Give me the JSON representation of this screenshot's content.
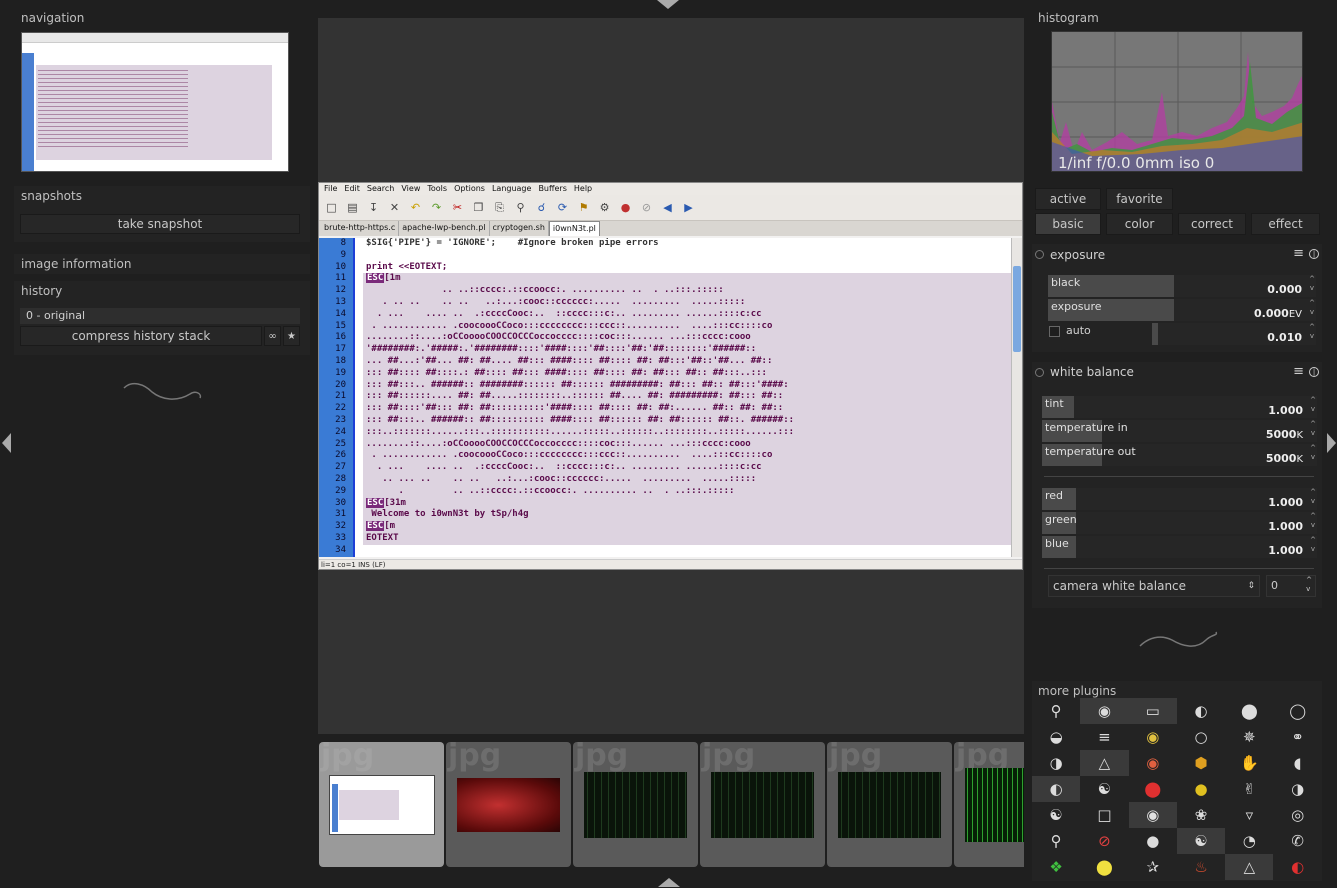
{
  "left": {
    "navigation_title": "navigation",
    "snapshots_title": "snapshots",
    "take_snapshot": "take snapshot",
    "image_info_title": "image information",
    "history_title": "history",
    "history_items": [
      "0 - original"
    ],
    "compress_history": "compress history stack"
  },
  "editor": {
    "menu": [
      "File",
      "Edit",
      "Search",
      "View",
      "Tools",
      "Options",
      "Language",
      "Buffers",
      "Help"
    ],
    "tabs": [
      "brute-http-https.c",
      "apache-lwp-bench.pl",
      "cryptogen.sh",
      "i0wnN3t.pl"
    ],
    "active_tab": 3,
    "line_numbers": [
      "8",
      "9",
      "10",
      "11",
      "12",
      "13",
      "14",
      "15",
      "16",
      "17",
      "18",
      "19",
      "20",
      "21",
      "22",
      "23",
      "24",
      "25",
      "26",
      "27",
      "28",
      "29",
      "30",
      "31",
      "32",
      "33",
      "34"
    ],
    "lines": [
      "$SIG{'PIPE'} = 'IGNORE';    #Ignore broken pipe errors",
      "",
      "print <<EOTEXT;",
      "ESC[1m",
      "              .. ..::cccc:.::ccoocc:. .......... ..  . ..:::.:::::",
      "   . .. ..    .. ..   ..:...:cooc::cccccc:.....  .........  .....:::::",
      "  . ...    .... ..  .:ccccCooc:..  ::cccc:::c:.. ......... ......::::c:cc",
      " . ............ .coocoooCCoco:::cccccccc:::ccc::..........  ....:::cc::::co",
      "........::....:oCCooooCOOCCOCCCoccocccc::::coc:::...... ...:::cccc:cooo",
      "'########:.'#####:.'########::::'####::::'##::::'##:'##::::::::'######::",
      "... ##...:'##... ##: ##.... ##::: ####:::: ##:::: ##: ##:::'##::'##... ##::",
      "::: ##:::: ##::::.: ##:::: ##::: ####:::: ##:::: ##: ##::: ##:: ##:::..:::",
      "::: ##:::.. ######:: ########:::::: ##:::::: #########: ##::: ##:: ##:::'####:",
      "::: ##::::::.... ##: ##.....::::::::..:::::: ##.... ##: #########: ##::: ##::",
      "::: ##::::'##::: ##: ##::::::::::'####:::: ##:::: ##: ##:...... ##:: ##: ##::",
      "::: ##:::.. ######:: ##:::::::::: ####:::: ##:::::: ##: ##:::::: ##::. ######::",
      ":::..:::::::......:::..:::::::::::......:::::..::::::..::::::::..:::::......:::",
      "........::....:oCCooooCOOCCOCCCoccocccc::::coc:::...... ...:::cccc:cooo",
      " . ............ .coocoooCCoco:::cccccccc:::ccc::..........  ....:::cc::::co",
      "  . ...    .... ..  .:ccccCooc:..  ::cccc:::c:.. ......... ......::::c:cc",
      "   .. ... ..    .. ..   ..:...:cooc::cccccc:.....  .........  .....:::::",
      "      .         .. ..::cccc:.::ccoocc:. .......... ..  . ..:::.:::::",
      "ESC[31m",
      " Welcome to i0wnN3t by tSp/h4g",
      "ESC[m",
      "EOTEXT",
      ""
    ],
    "status": "li=1 co=1 INS (LF)"
  },
  "filmstrip": {
    "ext_label": "jpg",
    "count": 6
  },
  "right": {
    "histogram_title": "histogram",
    "histogram_info": "1/inf f/0.0 0mm iso 0",
    "tabs_row1": [
      "active",
      "favorite"
    ],
    "tabs_row2": [
      "basic",
      "color",
      "correct",
      "effect"
    ],
    "exposure": {
      "title": "exposure",
      "black_label": "black",
      "black_value": "0.000",
      "exposure_label": "exposure",
      "exposure_value": "0.000",
      "exposure_unit": "EV",
      "auto_label": "auto",
      "auto_value": "0.010"
    },
    "white_balance": {
      "title": "white balance",
      "tint_label": "tint",
      "tint_value": "1.000",
      "temp_in_label": "temperature in",
      "temp_in_value": "5000",
      "temp_out_label": "temperature out",
      "temp_out_value": "5000",
      "temp_unit": "K",
      "red_label": "red",
      "red_value": "1.000",
      "green_label": "green",
      "green_value": "1.000",
      "blue_label": "blue",
      "blue_value": "1.000",
      "preset_label": "camera white balance",
      "preset_num": "0"
    },
    "more_plugins_title": "more plugins"
  }
}
